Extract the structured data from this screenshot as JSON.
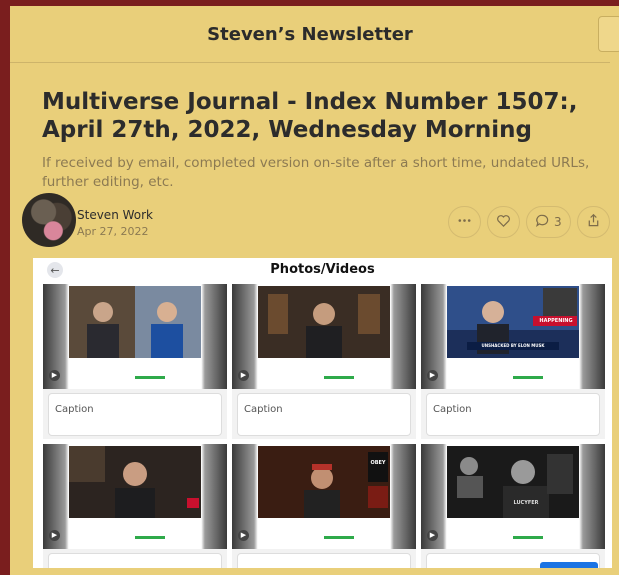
{
  "header": {
    "brand": "Steven’s Newsletter"
  },
  "post": {
    "title": "Multiverse Journal - Index Number 1507:, April 27th, 2022, Wednesday Morning",
    "subtitle": "If received by email, completed version on-site after a short time, undated URLs, further editing, etc.",
    "author": "Steven Work",
    "date": "Apr 27, 2022",
    "comment_count": "3"
  },
  "icons": [
    "more-icon",
    "heart-icon",
    "comment-icon",
    "share-icon",
    "back-arrow-icon",
    "play-icon"
  ],
  "colors": {
    "background": "#e9cf7a",
    "frame": "#7a1e1e",
    "link_blue": "#1b74e4",
    "progress_green": "#2eaa4a"
  },
  "screenshot": {
    "title": "Photos/Videos",
    "items": [
      {
        "caption": "Caption",
        "banner": "",
        "side_label": ""
      },
      {
        "caption": "Caption",
        "banner": "",
        "side_label": ""
      },
      {
        "caption": "Caption",
        "banner": "UNSHACKED BY ELON MUSK",
        "side_label": "HAPPENING"
      },
      {
        "caption": "",
        "banner": "",
        "side_label": ""
      },
      {
        "caption": "",
        "banner": "",
        "side_label": "OBEY"
      },
      {
        "caption": "",
        "banner": "",
        "side_label": "LUCYFER"
      }
    ]
  }
}
